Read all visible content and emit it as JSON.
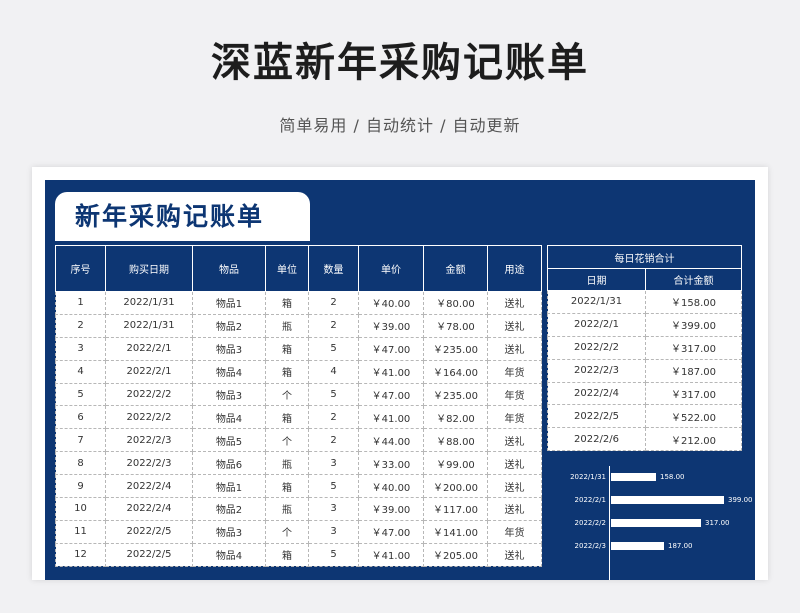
{
  "page": {
    "title": "深蓝新年采购记账单",
    "subtitle": "简单易用  /  自动统计  /  自动更新"
  },
  "sheet": {
    "title": "新年采购记账单",
    "main_headers": [
      "序号",
      "购买日期",
      "物品",
      "单位",
      "数量",
      "单价",
      "金额",
      "用途"
    ],
    "rows": [
      [
        "1",
        "2022/1/31",
        "物品1",
        "箱",
        "2",
        "￥40.00",
        "￥80.00",
        "送礼"
      ],
      [
        "2",
        "2022/1/31",
        "物品2",
        "瓶",
        "2",
        "￥39.00",
        "￥78.00",
        "送礼"
      ],
      [
        "3",
        "2022/2/1",
        "物品3",
        "箱",
        "5",
        "￥47.00",
        "￥235.00",
        "送礼"
      ],
      [
        "4",
        "2022/2/1",
        "物品4",
        "箱",
        "4",
        "￥41.00",
        "￥164.00",
        "年货"
      ],
      [
        "5",
        "2022/2/2",
        "物品3",
        "个",
        "5",
        "￥47.00",
        "￥235.00",
        "年货"
      ],
      [
        "6",
        "2022/2/2",
        "物品4",
        "箱",
        "2",
        "￥41.00",
        "￥82.00",
        "年货"
      ],
      [
        "7",
        "2022/2/3",
        "物品5",
        "个",
        "2",
        "￥44.00",
        "￥88.00",
        "送礼"
      ],
      [
        "8",
        "2022/2/3",
        "物品6",
        "瓶",
        "3",
        "￥33.00",
        "￥99.00",
        "送礼"
      ],
      [
        "9",
        "2022/2/4",
        "物品1",
        "箱",
        "5",
        "￥40.00",
        "￥200.00",
        "送礼"
      ],
      [
        "10",
        "2022/2/4",
        "物品2",
        "瓶",
        "3",
        "￥39.00",
        "￥117.00",
        "送礼"
      ],
      [
        "11",
        "2022/2/5",
        "物品3",
        "个",
        "3",
        "￥47.00",
        "￥141.00",
        "年货"
      ],
      [
        "12",
        "2022/2/5",
        "物品4",
        "箱",
        "5",
        "￥41.00",
        "￥205.00",
        "送礼"
      ]
    ],
    "daily": {
      "group_header": "每日花销合计",
      "headers": [
        "日期",
        "合计金额"
      ],
      "rows": [
        [
          "2022/1/31",
          "￥158.00"
        ],
        [
          "2022/2/1",
          "￥399.00"
        ],
        [
          "2022/2/2",
          "￥317.00"
        ],
        [
          "2022/2/3",
          "￥187.00"
        ],
        [
          "2022/2/4",
          "￥317.00"
        ],
        [
          "2022/2/5",
          "￥522.00"
        ],
        [
          "2022/2/6",
          "￥212.00"
        ]
      ]
    }
  },
  "colors": {
    "panel": "#0d3673",
    "bar": "#ffffff"
  },
  "chart_data": {
    "type": "bar",
    "orientation": "horizontal",
    "categories": [
      "2022/1/31",
      "2022/2/1",
      "2022/2/2",
      "2022/2/3"
    ],
    "values": [
      158.0,
      399.0,
      317.0,
      187.0
    ],
    "value_labels": [
      "158.00",
      "399.00",
      "317.00",
      "187.00"
    ]
  }
}
